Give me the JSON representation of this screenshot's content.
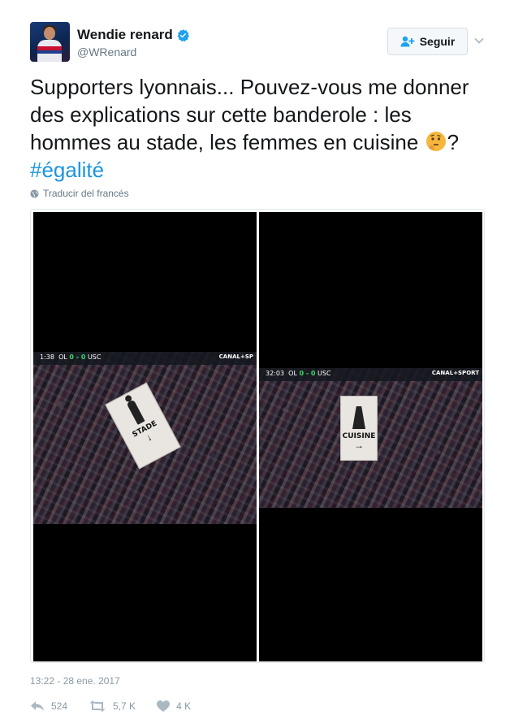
{
  "user": {
    "display_name": "Wendie renard",
    "handle": "@WRenard",
    "verified": true
  },
  "follow_button": {
    "label": "Seguir"
  },
  "tweet": {
    "text": "Supporters lyonnais... Pouvez-vous me donner des explications sur cette banderole : les hommes au stade, les femmes en cuisine ",
    "text_end": "?",
    "hashtag": "#égalité",
    "emoji": "thinking-face-icon"
  },
  "translate": {
    "label": "Traducir del francés"
  },
  "media": {
    "photos": [
      {
        "score_home": "OL",
        "score_value": "0 - 0",
        "score_away": "USC",
        "clock": "1:38",
        "channel": "CANAL+SP",
        "banner_text": "STADE"
      },
      {
        "score_home": "OL",
        "score_value": "0 - 0",
        "score_away": "USC",
        "clock": "32:03",
        "channel": "CANAL+SPORT",
        "banner_text": "CUISINE"
      }
    ]
  },
  "timestamp": "13:22 - 28 ene. 2017",
  "actions": {
    "replies": "524",
    "retweets": "5,7 K",
    "likes": "4 K"
  },
  "colors": {
    "link": "#1b95e0",
    "muted": "#657786",
    "verified": "#1da1f2"
  }
}
